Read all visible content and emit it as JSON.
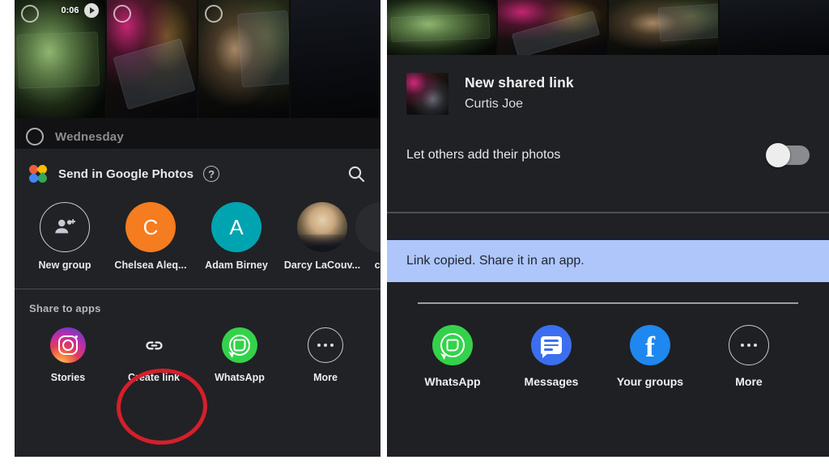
{
  "left_panel": {
    "photo_strip": {
      "video_duration": "0:06",
      "photos": [
        {
          "name": "video-thumbnail-landscape",
          "selected": false
        },
        {
          "name": "photo-thumbnail-phone",
          "selected": false
        },
        {
          "name": "photo-thumbnail-figure",
          "selected": false
        },
        {
          "name": "photo-thumbnail-screen",
          "selected": false
        }
      ]
    },
    "day_header": {
      "label": "Wednesday"
    },
    "share_sheet": {
      "title": "Send in Google Photos",
      "help_icon": "help-circle-icon",
      "search_icon": "search-icon",
      "logo_icon": "google-photos-logo",
      "contacts": [
        {
          "label": "New group",
          "avatar_kind": "outline-icon",
          "icon": "add-group-icon",
          "initial": "",
          "color": "#2a2b2e"
        },
        {
          "label": "Chelsea Aleq...",
          "avatar_kind": "initial",
          "icon": "",
          "initial": "C",
          "color": "#f57c1f"
        },
        {
          "label": "Adam Birney",
          "avatar_kind": "initial",
          "icon": "",
          "initial": "A",
          "color": "#00a4b0"
        },
        {
          "label": "Darcy LaCouv...",
          "avatar_kind": "photo",
          "icon": "",
          "initial": "",
          "color": "#6d5c44"
        },
        {
          "label": "cu",
          "avatar_kind": "initial",
          "icon": "",
          "initial": "",
          "color": "#2a2b2e"
        }
      ],
      "apps_heading": "Share to apps",
      "apps": [
        {
          "label": "Stories",
          "icon": "instagram-icon",
          "color": "#e23b5a"
        },
        {
          "label": "Create link",
          "icon": "link-icon",
          "color": "#e8e8ea"
        },
        {
          "label": "WhatsApp",
          "icon": "whatsapp-icon",
          "color": "#34d24b"
        },
        {
          "label": "More",
          "icon": "more-dots-icon",
          "color": "#c9c9cc"
        }
      ],
      "annotation": {
        "shape": "ellipse",
        "color": "#d41f2c",
        "target": "Create link"
      }
    }
  },
  "right_panel": {
    "link_header": {
      "title": "New shared link",
      "owner": "Curtis Joe",
      "thumbnail_icon": "shared-link-thumbnail"
    },
    "toggle_row": {
      "label": "Let others add their photos",
      "state": "off"
    },
    "banner": {
      "text": "Link copied. Share it in an app.",
      "background": "#aec6fa",
      "text_color": "#1f2430"
    },
    "apps": [
      {
        "label": "WhatsApp",
        "icon": "whatsapp-icon",
        "color": "#34d24b"
      },
      {
        "label": "Messages",
        "icon": "messages-icon",
        "color": "#3b6ff0"
      },
      {
        "label": "Your groups",
        "icon": "facebook-icon",
        "color": "#1e88f0"
      },
      {
        "label": "More",
        "icon": "more-dots-icon",
        "color": "#c9c9cc"
      }
    ]
  }
}
